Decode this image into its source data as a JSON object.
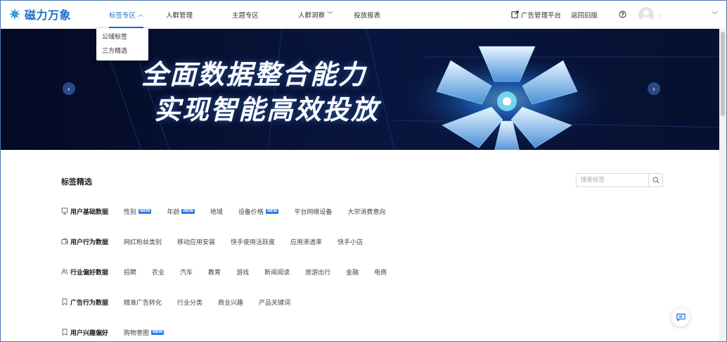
{
  "brand": {
    "name": "磁力万象"
  },
  "nav": {
    "items": [
      {
        "label": "标签专区"
      },
      {
        "label": "人群管理"
      },
      {
        "label": "主题专区"
      },
      {
        "label": "人群洞察"
      },
      {
        "label": "投放报表"
      }
    ]
  },
  "header_right": {
    "ad_platform": "广告管理平台",
    "back_old": "返回旧版",
    "user_name": "、"
  },
  "dropdown": {
    "items": [
      {
        "label": "公域标签"
      },
      {
        "label": "三方精选"
      }
    ]
  },
  "banner": {
    "line1": "全面数据整合能力",
    "line2": "实现智能高效投放"
  },
  "section": {
    "title": "标签精选",
    "search_placeholder": "搜索标签"
  },
  "badge_text": "NEW",
  "categories": [
    {
      "title": "用户基础数据",
      "icon": "monitor-icon",
      "tags": [
        {
          "label": "性别",
          "new": true
        },
        {
          "label": "年龄",
          "new": true
        },
        {
          "label": "地域"
        },
        {
          "label": "设备价格",
          "new": true
        },
        {
          "label": "平台网络设备"
        },
        {
          "label": "大宗消费意向"
        }
      ]
    },
    {
      "title": "用户行为数据",
      "icon": "wallet-icon",
      "tags": [
        {
          "label": "网红粉丝类别"
        },
        {
          "label": "移动应用安装"
        },
        {
          "label": "快手使用活跃度"
        },
        {
          "label": "应用渗透率"
        },
        {
          "label": "快手小店"
        }
      ]
    },
    {
      "title": "行业偏好数据",
      "icon": "users-icon",
      "tags": [
        {
          "label": "招聘"
        },
        {
          "label": "农业"
        },
        {
          "label": "汽车"
        },
        {
          "label": "教育"
        },
        {
          "label": "游戏"
        },
        {
          "label": "新闻阅读"
        },
        {
          "label": "旅游出行"
        },
        {
          "label": "金融"
        },
        {
          "label": "电商"
        }
      ]
    },
    {
      "title": "广告行为数据",
      "icon": "bookmark-icon",
      "tags": [
        {
          "label": "精准广告转化"
        },
        {
          "label": "行业分类"
        },
        {
          "label": "商业兴趣"
        },
        {
          "label": "产品关键词"
        }
      ]
    },
    {
      "title": "用户兴趣偏好",
      "icon": "bookmark-icon",
      "tags": [
        {
          "label": "购物意图",
          "new": true
        }
      ]
    }
  ],
  "colors": {
    "accent": "#1c6fc7",
    "badge": "#2f7fe6",
    "banner_bg": "#060c2a"
  }
}
